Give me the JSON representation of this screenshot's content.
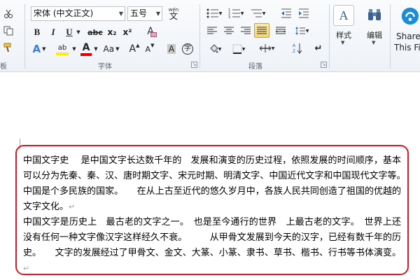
{
  "ribbon": {
    "clipboard": {
      "group_label": "板"
    },
    "font": {
      "group_label": "字体",
      "font_name": "宋体 (中文正文)",
      "font_size": "五号",
      "wen_label": "wén",
      "wen_char": "文",
      "bold": "B",
      "italic": "I",
      "underline": "U",
      "strikethrough": "abc",
      "subscript": "x₂",
      "superscript": "x²",
      "clear_format": "A",
      "text_effects": "A",
      "highlight": "ab",
      "font_color": "A",
      "change_case": "Aa",
      "grow_font": "A",
      "shrink_font": "A",
      "char_shading": "A",
      "enclose": "字"
    },
    "paragraph": {
      "group_label": "段落"
    },
    "styles": {
      "label": "样式"
    },
    "editing": {
      "label": "编辑"
    },
    "share": {
      "label_line1": "Share",
      "label_line2": "This Fi"
    }
  },
  "document": {
    "paragraph1": "中国文字史　 是中国文字长达数千年的　发展和演变的历史过程，依照发展的时间顺序，基本可以分为先秦、秦、汉、唐时期文字、宋元时期、明清文字、中国近代文字和中国现代文字等。　中国是个多民族的国家。　　在从上古至近代的悠久岁月中，各族人民共同创造了祖国的优越的文字文化。",
    "paragraph2": "中国文字是历史上　最古老的文字之一。　也是至今通行的世界　上最古老的文字。　世界上还没有任何一种文字像汉字这样经久不衰。　　　从甲骨文发展到今天的汉字，已经有数千年的历史。　　文字的发展经过了甲骨文、金文、大篆、小篆、隶书、草书、楷书、行书等书体演变。",
    "paragraph_mark": "↵"
  },
  "colors": {
    "annotation_border": "#e0141e",
    "font_color_bar": "#e00000",
    "highlight_bar": "#ffee00"
  }
}
